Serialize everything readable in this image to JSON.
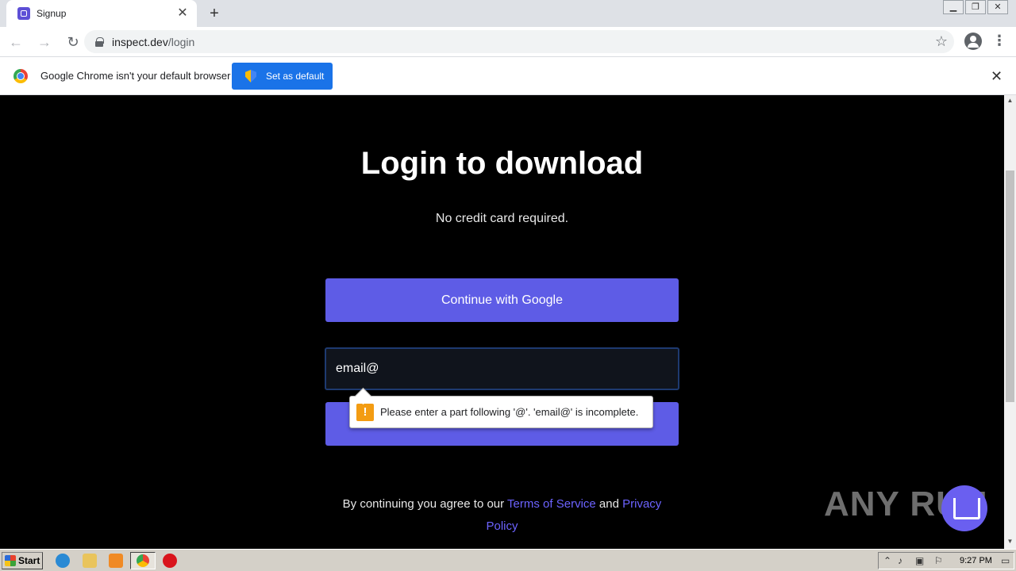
{
  "browser": {
    "tab_title": "Signup",
    "tab_close": "✕",
    "new_tab": "+",
    "url_host": "inspect.dev",
    "url_path": "/login",
    "back": "←",
    "forward": "→",
    "reload": "↻",
    "star": "☆",
    "menu": "⋮",
    "win_min": "▁",
    "win_max": "❐",
    "win_close": "✕"
  },
  "infobar": {
    "message": "Google Chrome isn't your default browser",
    "button_label": "Set as default",
    "close": "✕"
  },
  "page": {
    "heading": "Login to download",
    "subheading": "No credit card required.",
    "google_button": "Continue with Google",
    "email_value": "email@",
    "validation_message": "Please enter a part following '@'. 'email@' is incomplete.",
    "warning_glyph": "!",
    "terms_prefix": "By continuing you agree to our ",
    "terms_link": "Terms of Service",
    "terms_and": " and ",
    "privacy_link": "Privacy Policy"
  },
  "watermark": {
    "text": "ANY RUN"
  },
  "taskbar": {
    "start_label": "Start",
    "clock": "9:27 PM"
  },
  "colors": {
    "accent_button": "#5e5ce6",
    "link": "#6c63ff",
    "chrome_blue": "#1a73e8"
  }
}
